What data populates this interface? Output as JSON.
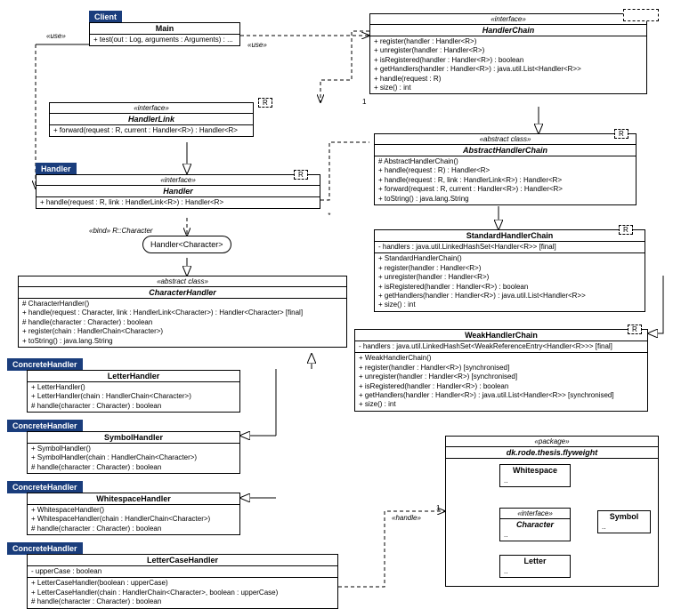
{
  "tags": {
    "client": "Client",
    "handler": "Handler",
    "ch1": "ConcreteHandler",
    "ch2": "ConcreteHandler",
    "ch3": "ConcreteHandler",
    "ch4": "ConcreteHandler"
  },
  "main": {
    "name": "Main",
    "op": "+ test(out : Log, arguments : Arguments) : ..."
  },
  "hlink": {
    "st": "«interface»",
    "name": "HandlerLink",
    "op": "+ forward(request : R, current : Handler<R>) : Handler<R>"
  },
  "hnd": {
    "st": "«interface»",
    "name": "Handler",
    "op": "+ handle(request : R, link : HandlerLink<R>) : Handler<R>"
  },
  "bub": {
    "t": "Handler<Character>"
  },
  "bind": "«bind» R::Character",
  "chh": {
    "st": "«abstract class»",
    "name": "CharacterHandler",
    "a1": "# CharacterHandler()",
    "a2": "+ handle(request : Character, link : HandlerLink<Character>) : Handler<Character>  [final]",
    "a3": "# handle(character : Character) : boolean",
    "a4": "+ register(chain : HandlerChain<Character>)",
    "a5": "+ toString() : java.lang.String"
  },
  "lh": {
    "name": "LetterHandler",
    "a1": "+ LetterHandler()",
    "a2": "+ LetterHandler(chain : HandlerChain<Character>)",
    "a3": "# handle(character : Character) : boolean"
  },
  "sh": {
    "name": "SymbolHandler",
    "a1": "+ SymbolHandler()",
    "a2": "+ SymbolHandler(chain : HandlerChain<Character>)",
    "a3": "# handle(character : Character) : boolean"
  },
  "wh": {
    "name": "WhitespaceHandler",
    "a1": "+ WhitespaceHandler()",
    "a2": "+ WhitespaceHandler(chain : HandlerChain<Character>)",
    "a3": "# handle(character : Character) : boolean"
  },
  "lch": {
    "name": "LetterCaseHandler",
    "f": "- upperCase : boolean",
    "a1": "+ LetterCaseHandler(boolean : upperCase)",
    "a2": "+ LetterCaseHandler(chain : HandlerChain<Character>, boolean : upperCase)",
    "a3": "# handle(character : Character) : boolean"
  },
  "hc": {
    "st": "«interface»",
    "name": "HandlerChain",
    "a1": "+ register(handler : Handler<R>)",
    "a2": "+ unregister(handler : Handler<R>)",
    "a3": "+ isRegistered(handler : Handler<R>) : boolean",
    "a4": "+ getHandlers(handler : Handler<R>) : java.util.List<Handler<R>>",
    "a5": "+ handle(request : R)",
    "a6": "+ size() : int"
  },
  "ahc": {
    "st": "«abstract class»",
    "name": "AbstractHandlerChain",
    "a1": "# AbstractHandlerChain()",
    "a2": "+ handle(request : R) : Handler<R>",
    "a3": "+ handle(request : R, link : HandlerLink<R>) : Handler<R>",
    "a4": "+ forward(request : R, current : Handler<R>) : Handler<R>",
    "a5": "+ toString() : java.lang.String"
  },
  "shc": {
    "name": "StandardHandlerChain",
    "f": "- handlers : java.util.LinkedHashSet<Handler<R>>  [final]",
    "a1": "+ StandardHandlerChain()",
    "a2": "+ register(handler : Handler<R>)",
    "a3": "+ unregister(handler : Handler<R>)",
    "a4": "+ isRegistered(handler : Handler<R>) : boolean",
    "a5": "+ getHandlers(handler : Handler<R>) : java.util.List<Handler<R>>",
    "a6": "+ size() : int"
  },
  "whc": {
    "name": "WeakHandlerChain",
    "f": "- handlers : java.util.LinkedHashSet<WeakReferenceEntry<Handler<R>>>  [final]",
    "a1": "+ WeakHandlerChain()",
    "a2": "+ register(handler : Handler<R>)  [synchronised]",
    "a3": "+ unregister(handler : Handler<R>)  [synchronised]",
    "a4": "+ isRegistered(handler : Handler<R>) : boolean",
    "a5": "+ getHandlers(handler : Handler<R>) : java.util.List<Handler<R>>  [synchronised]",
    "a6": "+ size() : int"
  },
  "pkg": {
    "st": "«package»",
    "name": "dk.rode.thesis.flyweight",
    "ws": "Whitespace",
    "sym": "Symbol",
    "let": "Letter",
    "ch": "Character",
    "chi": "«interface»"
  },
  "lbls": {
    "use": "«use»",
    "handle": "«handle»",
    "R": "R",
    "one": "1",
    "star": "*"
  }
}
